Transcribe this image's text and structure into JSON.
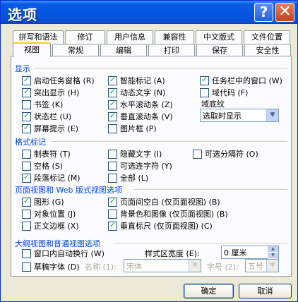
{
  "window": {
    "title": "选项",
    "help_glyph": "?",
    "close_glyph": "✕"
  },
  "tabs_back": [
    "拼写和语法",
    "修订",
    "用户信息",
    "兼容性",
    "中文版式",
    "文件位置"
  ],
  "tabs_front": [
    "视图",
    "常规",
    "编辑",
    "打印",
    "保存",
    "安全性"
  ],
  "show": {
    "title": "显示",
    "items": [
      {
        "label": "启动任务窗格 (R)",
        "checked": true
      },
      {
        "label": "突出显示 (H)",
        "checked": true
      },
      {
        "label": "书签 (K)",
        "checked": false
      },
      {
        "label": "状态栏 (U)",
        "checked": true
      },
      {
        "label": "屏幕提示 (E)",
        "checked": true
      },
      {
        "label": "智能标记 (A)",
        "checked": true
      },
      {
        "label": "动态文字 (N)",
        "checked": true
      },
      {
        "label": "水平滚动条 (Z)",
        "checked": true
      },
      {
        "label": "垂直滚动条 (V)",
        "checked": true
      },
      {
        "label": "图片框 (P)",
        "checked": false
      },
      {
        "label": "任务栏中的窗口 (W)",
        "checked": true
      },
      {
        "label": "域代码 (F)",
        "checked": false
      }
    ],
    "field_shading_label": "域底纹",
    "field_shading_value": "选取时显示"
  },
  "format_marks": {
    "title": "格式标记",
    "items": [
      {
        "label": "制表符 (T)",
        "checked": false
      },
      {
        "label": "空格 (S)",
        "checked": false
      },
      {
        "label": "段落标记 (M)",
        "checked": true
      },
      {
        "label": "隐藏文字 (I)",
        "checked": false
      },
      {
        "label": "可选连字符 (Y)",
        "checked": false
      },
      {
        "label": "全部 (L)",
        "checked": false
      },
      {
        "label": "可选分隔符 (O)",
        "checked": false
      }
    ]
  },
  "page_web": {
    "title": "页面视图和 Web 版式视图选项",
    "items": [
      {
        "label": "图形 (G)",
        "checked": true
      },
      {
        "label": "对象位置 (J)",
        "checked": false
      },
      {
        "label": "正文边框 (X)",
        "checked": false
      },
      {
        "label": "页面间空白 (仅页面视图) (B)",
        "checked": true
      },
      {
        "label": "背景色和图像 (仅页面视图) (B)",
        "checked": false
      },
      {
        "label": "垂直标尺 (仅页面视图) (C)",
        "checked": true
      }
    ]
  },
  "outline": {
    "title": "大纲视图和普通视图选项",
    "items": [
      {
        "label": "窗口内自动换行 (W)",
        "checked": false
      },
      {
        "label": "草稿字体 (D)",
        "checked": false
      }
    ],
    "style_width_label": "样式区宽度 (E):",
    "style_width_value": "0 厘米",
    "name_label": "名称 (1):",
    "name_value": "宋体",
    "size_label": "字号 (2):",
    "size_value": "五号"
  },
  "buttons": {
    "ok": "确定",
    "cancel": "取消"
  }
}
